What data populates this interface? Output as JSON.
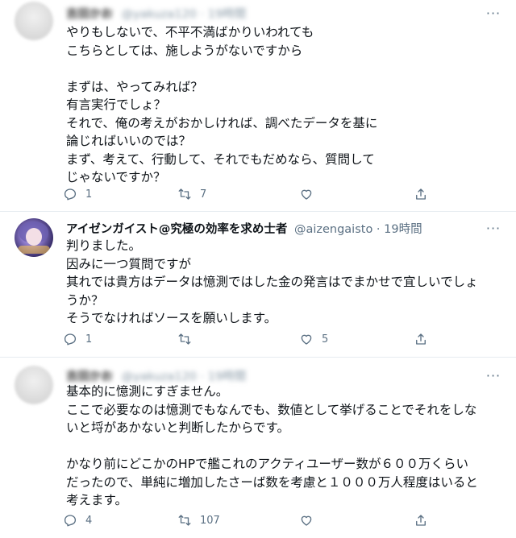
{
  "tweets": [
    {
      "author_name": "吉田かお",
      "author_handle": "@yakuza120 · 19時間",
      "body": "やりもしないで、不平不満ばかりいわれても\nこちらとしては、施しようがないですから\n\nまずは、やってみれば？\n有言実行でしょ？\nそれで、俺の考えがおかしければ、調べたデータを基に\n論じればいいのでは？\nまず、考えて、行動して、それでもだめなら、質問して\nじゃないですか？",
      "reply_count": "1",
      "retweet_count": "7",
      "like_count": "",
      "blurred": true
    },
    {
      "author_name": "アイゼンガイスト@究極の効率を求め士者",
      "author_handle": "@aizengaisto · 19時間",
      "body": "判りました。\n因みに一つ質問ですが\n其れでは貴方はデータは憶測ではした金の発言はでまかせで宜しいでしょ\nうか？\nそうでなければソースを願いします。",
      "reply_count": "1",
      "retweet_count": "",
      "like_count": "5",
      "blurred": false
    },
    {
      "author_name": "吉田かお",
      "author_handle": "@yakuza120 · 19時間",
      "body": "基本的に憶測にすぎません。\nここで必要なのは憶測でもなんでも、数値として挙げることでそれをしな\nいと埒があかないと判断したからです。\n\nかなり前にどこかのHPで艦これのアクティユーザー数が６００万くらい\nだったので、単純に増加したさーば数を考慮と１０００万人程度はいると\n考えます。",
      "reply_count": "4",
      "retweet_count": "107",
      "like_count": "",
      "blurred": true
    }
  ],
  "icons": {
    "reply": "reply-icon",
    "retweet": "retweet-icon",
    "like": "heart-icon",
    "share": "share-icon",
    "more": "more-icon"
  },
  "more_label": "···"
}
